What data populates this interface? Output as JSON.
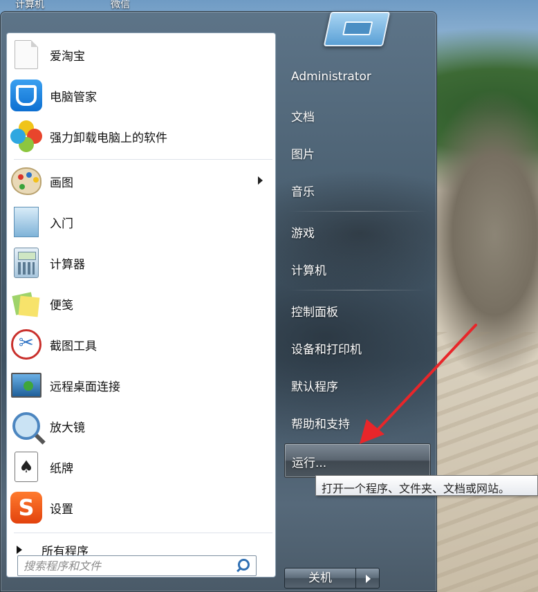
{
  "desktop": {
    "icon_labels": [
      "计算机",
      "微信"
    ]
  },
  "start_menu": {
    "pinned": [
      {
        "label": "爱淘宝",
        "icon": "document-icon"
      },
      {
        "label": "电脑管家",
        "icon": "shield-icon"
      },
      {
        "label": "强力卸载电脑上的软件",
        "icon": "flower-icon"
      }
    ],
    "recent": [
      {
        "label": "画图",
        "icon": "paint-palette-icon",
        "has_submenu": true
      },
      {
        "label": "入门",
        "icon": "getting-started-icon"
      },
      {
        "label": "计算器",
        "icon": "calculator-icon"
      },
      {
        "label": "便笺",
        "icon": "sticky-notes-icon"
      },
      {
        "label": "截图工具",
        "icon": "snipping-tool-icon"
      },
      {
        "label": "远程桌面连接",
        "icon": "remote-desktop-icon"
      },
      {
        "label": "放大镜",
        "icon": "magnifier-icon"
      },
      {
        "label": "纸牌",
        "icon": "solitaire-cards-icon"
      },
      {
        "label": "设置",
        "icon": "sogou-s-icon"
      }
    ],
    "all_programs_label": "所有程序",
    "search": {
      "placeholder": "搜索程序和文件",
      "value": ""
    },
    "right_pane": {
      "user_name": "Administrator",
      "group1": [
        "文档",
        "图片",
        "音乐"
      ],
      "group2": [
        "游戏",
        "计算机"
      ],
      "group3": [
        "控制面板",
        "设备和打印机",
        "默认程序",
        "帮助和支持"
      ],
      "run_label": "运行...",
      "run_tooltip": "打开一个程序、文件夹、文档或网站。"
    },
    "shutdown_label": "关机"
  },
  "colors": {
    "annotation_arrow": "#e8262a",
    "menu_glass": "#4a5f70",
    "left_pane": "#ffffff"
  }
}
